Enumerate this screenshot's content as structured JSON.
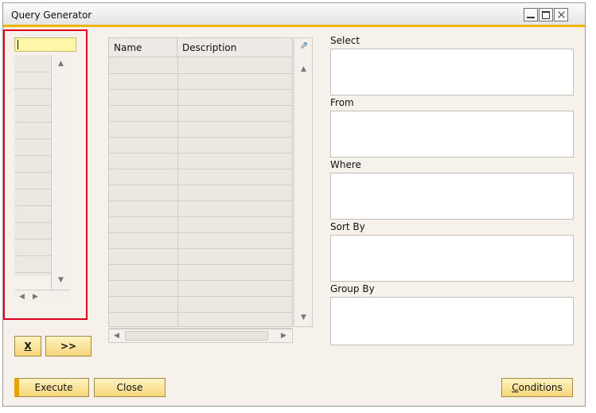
{
  "window": {
    "title": "Query Generator"
  },
  "fields_table": {
    "columns": [
      "Name",
      "Description"
    ]
  },
  "sql_sections": {
    "select_label": "Select",
    "from_label": "From",
    "where_label": "Where",
    "sort_by_label": "Sort By",
    "group_by_label": "Group By"
  },
  "buttons": {
    "clear": "X",
    "add": ">>",
    "execute": "Execute",
    "close": "Close",
    "conditions": "Conditions"
  },
  "colors": {
    "accent": "#f0b400",
    "highlight": "#e0001a",
    "button": "#f6d67a",
    "input_active": "#fff6a8"
  },
  "icons": [
    "minimize-icon",
    "maximize-icon",
    "close-icon",
    "expand-arrow-icon",
    "scroll-up-icon",
    "scroll-down-icon",
    "scroll-left-icon",
    "scroll-right-icon"
  ]
}
